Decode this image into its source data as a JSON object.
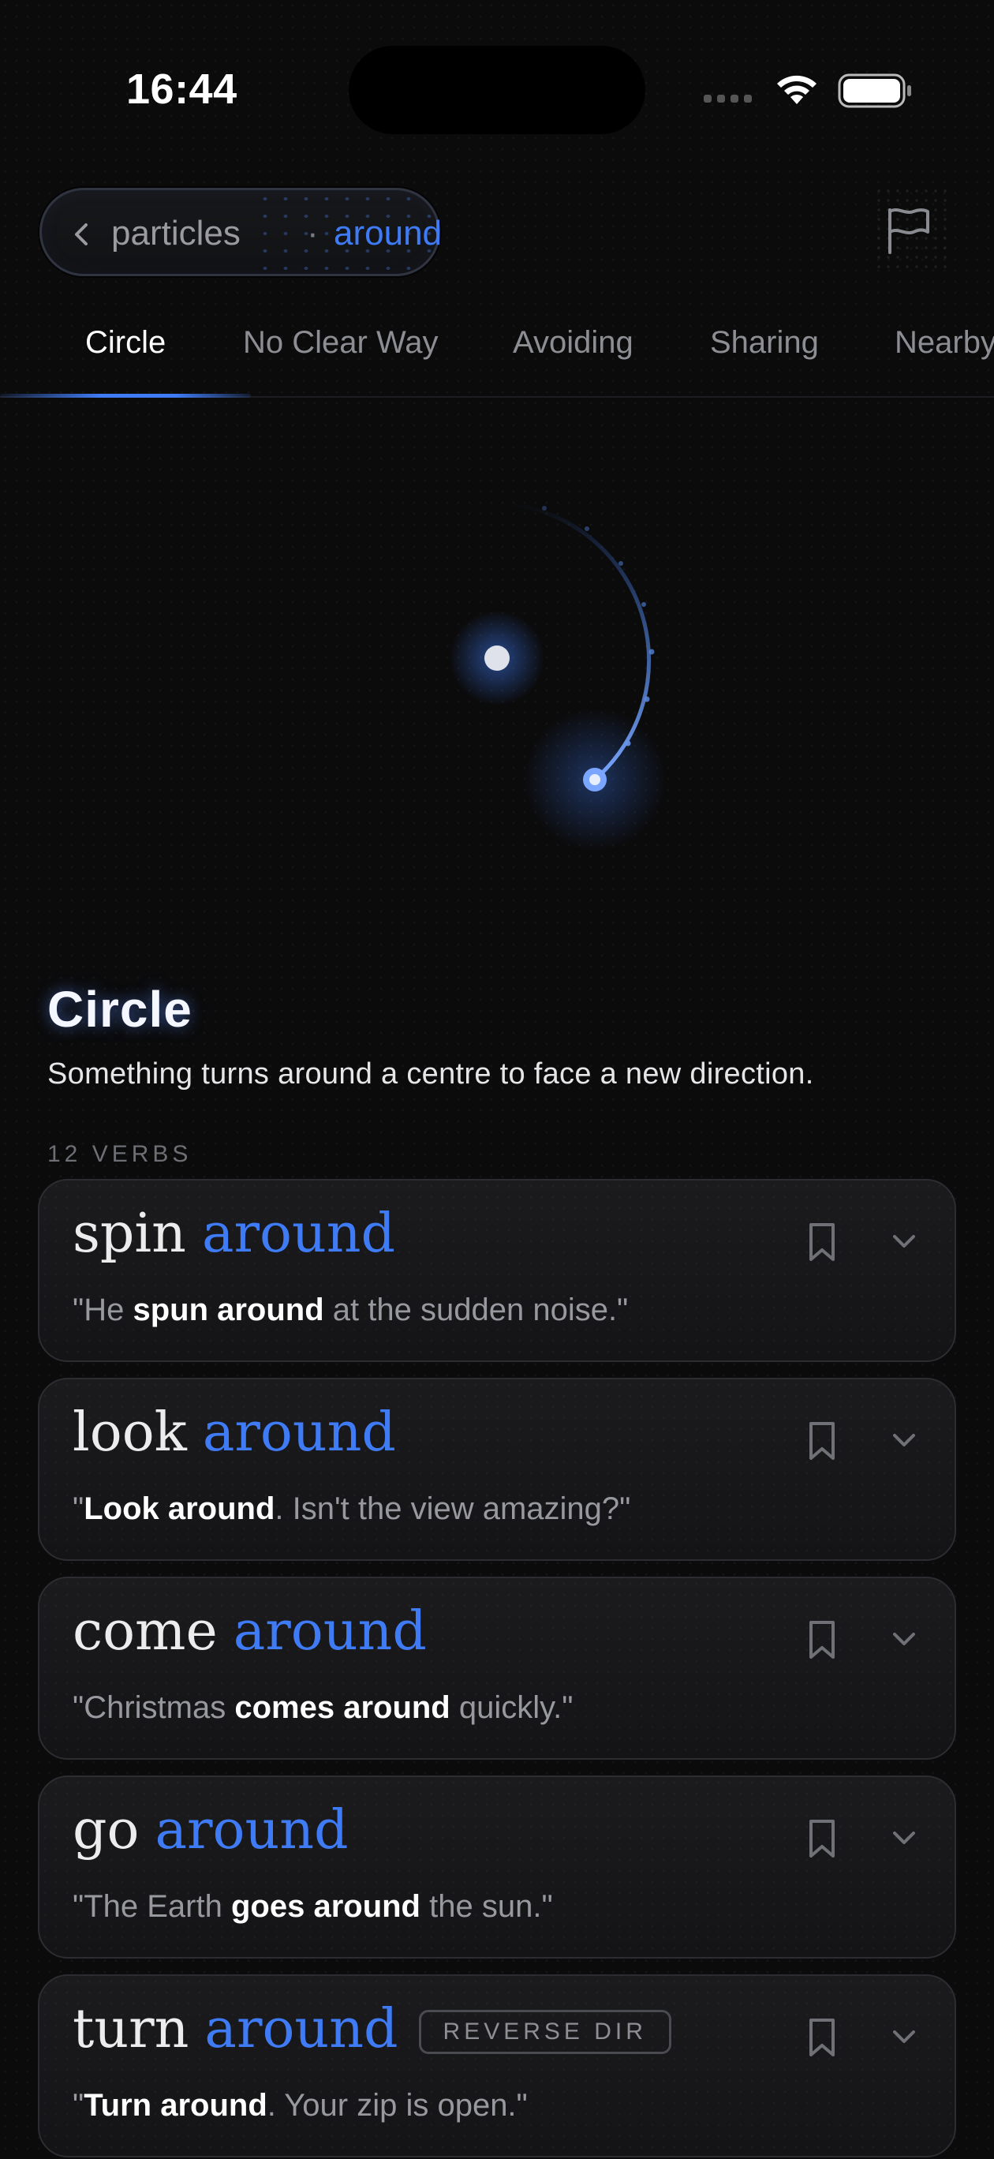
{
  "status_bar": {
    "time": "16:44"
  },
  "breadcrumb": {
    "parent": "particles",
    "separator": "·",
    "current": "around"
  },
  "tabs": [
    {
      "label": "Circle",
      "active": true
    },
    {
      "label": "No Clear Way",
      "active": false
    },
    {
      "label": "Avoiding",
      "active": false
    },
    {
      "label": "Sharing",
      "active": false
    },
    {
      "label": "Nearby",
      "active": false
    }
  ],
  "meaning": {
    "title": "Circle",
    "description": "Something turns around a centre to face a new direction.",
    "verb_count": "12 VERBS"
  },
  "verbs": [
    {
      "verb": "spin",
      "particle": "around",
      "tag": "",
      "example": {
        "before": "\"He ",
        "bold": "spun around",
        "after": " at the sudden noise.\""
      }
    },
    {
      "verb": "look",
      "particle": "around",
      "tag": "",
      "example": {
        "before": "\"",
        "bold": "Look around",
        "after": ". Isn't the view amazing?\""
      }
    },
    {
      "verb": "come",
      "particle": "around",
      "tag": "",
      "example": {
        "before": "\"Christmas ",
        "bold": "comes around",
        "after": " quickly.\""
      }
    },
    {
      "verb": "go",
      "particle": "around",
      "tag": "",
      "example": {
        "before": "\"The Earth ",
        "bold": "goes around",
        "after": " the sun.\""
      }
    },
    {
      "verb": "turn",
      "particle": "around",
      "tag": "REVERSE DIR",
      "example": {
        "before": "\"",
        "bold": "Turn around",
        "after": ". Your zip is open.\""
      }
    }
  ],
  "colors": {
    "accent": "#3f7bf5",
    "background": "#0b0b0c",
    "card": "#18181a"
  },
  "icons": {
    "back": "chevron-left-icon",
    "flag": "flag-icon",
    "bookmark": "bookmark-icon",
    "expand": "chevron-down-icon"
  }
}
